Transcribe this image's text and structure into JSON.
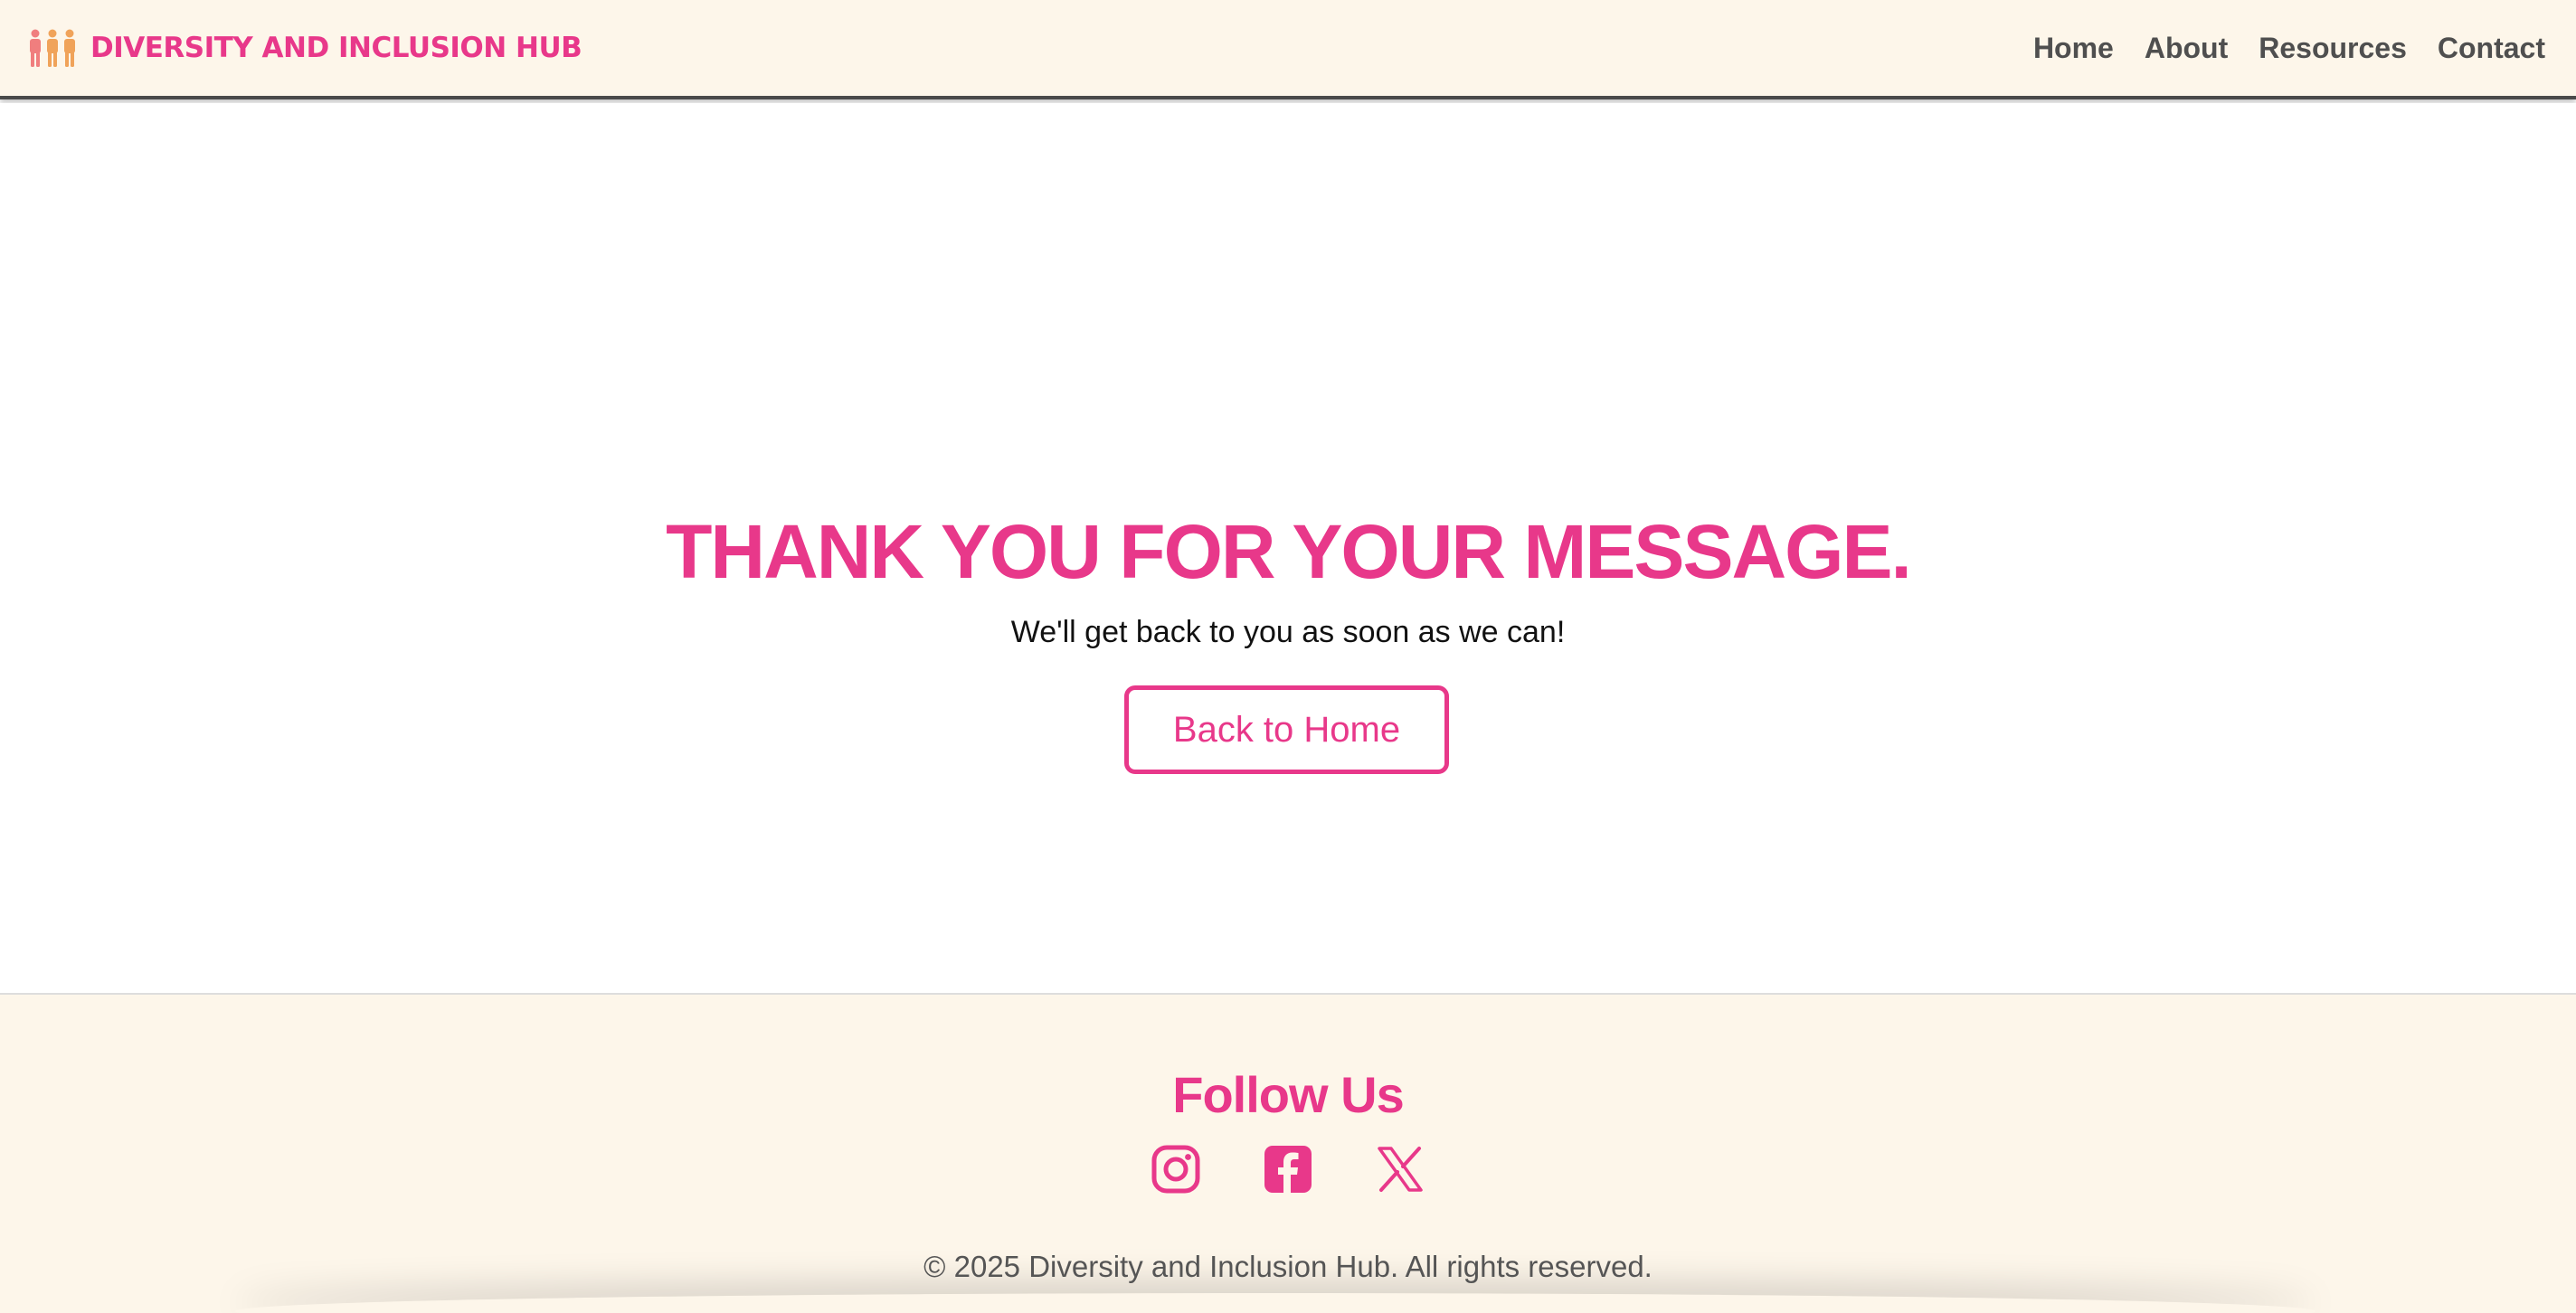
{
  "colors": {
    "accent": "#e8388a",
    "header_bg": "#fdf6ea",
    "footer_bg": "#fdf6ea",
    "nav_text": "#4f4f4f",
    "body_text": "#111111",
    "logo_people": [
      "#f07e7e",
      "#f0a35a",
      "#f0a35a"
    ]
  },
  "header": {
    "logo_icon": "people-group-icon",
    "brand_title": "DIVERSITY AND INCLUSION HUB",
    "nav": [
      "Home",
      "About",
      "Resources",
      "Contact"
    ]
  },
  "main": {
    "title": "THANK YOU FOR YOUR MESSAGE.",
    "subtitle": "We'll get back to you as soon as we can!",
    "back_button_label": "Back to Home"
  },
  "footer": {
    "follow_title": "Follow Us",
    "social_icons": [
      "instagram-icon",
      "facebook-icon",
      "x-icon"
    ],
    "copyright": "© 2025 Diversity and Inclusion Hub. All rights reserved."
  }
}
